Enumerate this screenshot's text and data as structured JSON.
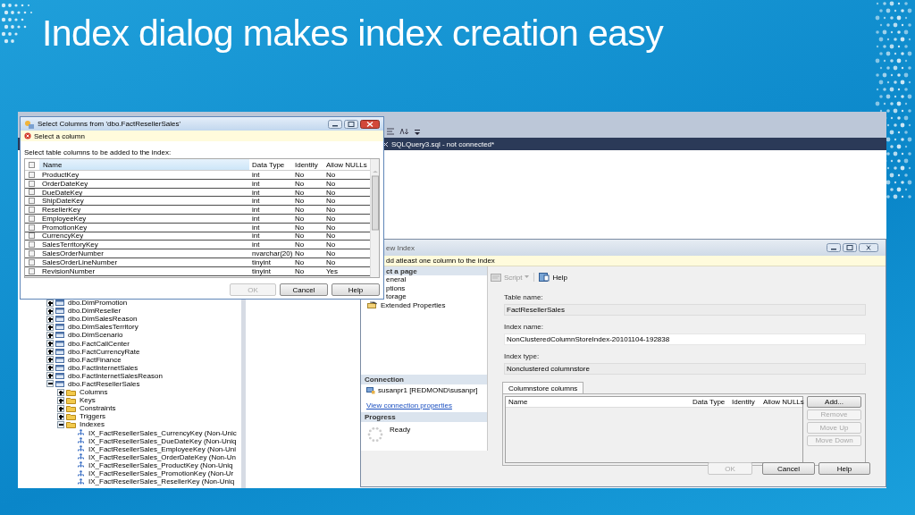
{
  "slide": {
    "title": "Index dialog makes index creation easy"
  },
  "ssms": {
    "tab": {
      "title": "SQLQuery3.sql - not connected*"
    },
    "tree": [
      {
        "label": "dbo.DimPromotion",
        "kind": "table",
        "expanded": false
      },
      {
        "label": "dbo.DimReseller",
        "kind": "table",
        "expanded": false
      },
      {
        "label": "dbo.DimSalesReason",
        "kind": "table",
        "expanded": false
      },
      {
        "label": "dbo.DimSalesTerritory",
        "kind": "table",
        "expanded": false
      },
      {
        "label": "dbo.DimScenario",
        "kind": "table",
        "expanded": false
      },
      {
        "label": "dbo.FactCallCenter",
        "kind": "table",
        "expanded": false
      },
      {
        "label": "dbo.FactCurrencyRate",
        "kind": "table",
        "expanded": false
      },
      {
        "label": "dbo.FactFinance",
        "kind": "table",
        "expanded": false
      },
      {
        "label": "dbo.FactInternetSales",
        "kind": "table",
        "expanded": false
      },
      {
        "label": "dbo.FactInternetSalesReason",
        "kind": "table",
        "expanded": false
      },
      {
        "label": "dbo.FactResellerSales",
        "kind": "table",
        "expanded": true,
        "children": [
          {
            "label": "Columns",
            "kind": "folder",
            "expanded": false
          },
          {
            "label": "Keys",
            "kind": "folder",
            "expanded": false
          },
          {
            "label": "Constraints",
            "kind": "folder",
            "expanded": false
          },
          {
            "label": "Triggers",
            "kind": "folder",
            "expanded": false
          },
          {
            "label": "Indexes",
            "kind": "folder",
            "expanded": true,
            "children": [
              {
                "label": "IX_FactResellerSales_CurrencyKey (Non-Unic",
                "kind": "index"
              },
              {
                "label": "IX_FactResellerSales_DueDateKey (Non-Uniq",
                "kind": "index"
              },
              {
                "label": "IX_FactResellerSales_EmployeeKey (Non-Uni",
                "kind": "index"
              },
              {
                "label": "IX_FactResellerSales_OrderDateKey (Non-Un",
                "kind": "index"
              },
              {
                "label": "IX_FactResellerSales_ProductKey (Non-Uniq",
                "kind": "index"
              },
              {
                "label": "IX_FactResellerSales_PromotionKey (Non-Ur",
                "kind": "index"
              },
              {
                "label": "IX_FactResellerSales_ResellerKey (Non-Uniq",
                "kind": "index"
              }
            ]
          }
        ]
      }
    ]
  },
  "select_columns": {
    "title": "Select Columns from 'dbo.FactResellerSales'",
    "message": "Select a column",
    "instruction": "Select table columns to be added to the index:",
    "header_checked": false,
    "columns": [
      "Name",
      "Data Type",
      "Identity",
      "Allow NULLs"
    ],
    "rows": [
      {
        "checked": false,
        "cells": [
          "ProductKey",
          "int",
          "No",
          "No"
        ]
      },
      {
        "checked": false,
        "cells": [
          "OrderDateKey",
          "int",
          "No",
          "No"
        ]
      },
      {
        "checked": false,
        "cells": [
          "DueDateKey",
          "int",
          "No",
          "No"
        ]
      },
      {
        "checked": false,
        "cells": [
          "ShipDateKey",
          "int",
          "No",
          "No"
        ]
      },
      {
        "checked": false,
        "cells": [
          "ResellerKey",
          "int",
          "No",
          "No"
        ]
      },
      {
        "checked": false,
        "cells": [
          "EmployeeKey",
          "int",
          "No",
          "No"
        ]
      },
      {
        "checked": false,
        "cells": [
          "PromotionKey",
          "int",
          "No",
          "No"
        ]
      },
      {
        "checked": false,
        "cells": [
          "CurrencyKey",
          "int",
          "No",
          "No"
        ]
      },
      {
        "checked": false,
        "cells": [
          "SalesTerritoryKey",
          "int",
          "No",
          "No"
        ]
      },
      {
        "checked": false,
        "cells": [
          "SalesOrderNumber",
          "nvarchar(20)",
          "No",
          "No"
        ]
      },
      {
        "checked": false,
        "cells": [
          "SalesOrderLineNumber",
          "tinyint",
          "No",
          "No"
        ]
      },
      {
        "checked": false,
        "cells": [
          "RevisionNumber",
          "tinyint",
          "No",
          "Yes"
        ]
      }
    ],
    "buttons": [
      {
        "label": "OK",
        "disabled": true
      },
      {
        "label": "Cancel",
        "disabled": false
      },
      {
        "label": "Help",
        "disabled": false
      }
    ]
  },
  "new_index": {
    "title": "ew Index",
    "message": "dd atleast one column to the index",
    "pages_header": "ct a page",
    "pages": [
      {
        "label": "eneral",
        "icon_visible": false
      },
      {
        "label": "ptions",
        "icon_visible": false
      },
      {
        "label": "torage",
        "icon_visible": false
      },
      {
        "label": "Extended Properties",
        "icon_visible": true
      }
    ],
    "connection": {
      "header": "Connection",
      "server": "susanpr1 [REDMOND\\susanpr]",
      "link": "View connection properties"
    },
    "progress": {
      "header": "Progress",
      "status": "Ready"
    },
    "toolbar": [
      {
        "label": "Script",
        "kind": "script",
        "disabled": true
      },
      {
        "label": "Help",
        "kind": "help",
        "disabled": false
      }
    ],
    "fields": [
      {
        "label": "Table name:",
        "value": "FactResellerSales",
        "editable": false
      },
      {
        "label": "Index name:",
        "value": "NonClusteredColumnStoreIndex-20101104-192838",
        "editable": true
      },
      {
        "label": "Index type:",
        "value": "Nonclustered columnstore",
        "editable": false
      }
    ],
    "tab": {
      "label": "Columnstore columns",
      "selected": true
    },
    "columns": [
      "Name",
      "Data Type",
      "Identity",
      "Allow NULLs"
    ],
    "side_buttons": [
      {
        "label": "Add...",
        "disabled": false
      },
      {
        "label": "Remove",
        "disabled": true
      },
      {
        "label": "Move Up",
        "disabled": true
      },
      {
        "label": "Move Down",
        "disabled": true
      }
    ],
    "buttons": [
      {
        "label": "OK",
        "disabled": true
      },
      {
        "label": "Cancel",
        "disabled": false
      },
      {
        "label": "Help",
        "disabled": false
      }
    ]
  }
}
